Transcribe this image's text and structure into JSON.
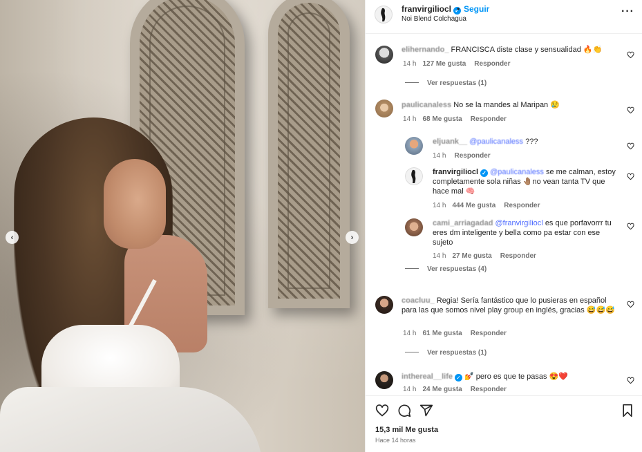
{
  "colors": {
    "accent": "#0095f6",
    "mention": "#4e6bff",
    "muted": "#737373",
    "text": "#262626"
  },
  "photo": {
    "prev_icon": "chevron-left-icon",
    "next_icon": "chevron-right-icon"
  },
  "header": {
    "username": "franvirgiliocl",
    "separator": "•",
    "follow_label": "Seguir",
    "location": "Noi Blend Colchagua",
    "more_icon": "more-options-icon"
  },
  "comments": [
    {
      "user": "elihernando_",
      "text": "FRANCISCA diste clase y sensualidad 🔥👏",
      "time": "14 h",
      "likes": "127 Me gusta",
      "reply": "Responder",
      "view_replies": "Ver respuestas (1)"
    },
    {
      "user": "paulicanaless",
      "text": "No se la mandes al Maripan 😢",
      "time": "14 h",
      "likes": "68 Me gusta",
      "reply": "Responder",
      "replies": [
        {
          "user": "eljuank__",
          "mention": "@paulicanaless",
          "text": "???",
          "time": "14 h",
          "reply": "Responder"
        },
        {
          "user": "franvirgiliocl",
          "mention": "@paulicanaless",
          "text": "se me calman, estoy completamente sola niñas 🤚🏽no vean tanta TV que hace mal 🧠",
          "time": "14 h",
          "likes": "444 Me gusta",
          "reply": "Responder"
        },
        {
          "user": "cami_arriagadad",
          "mention": "@franvirgiliocl",
          "text": "es que porfavorrr tu eres dm inteligente y bella como pa estar con ese sujeto",
          "time": "14 h",
          "likes": "27 Me gusta",
          "reply": "Responder"
        }
      ],
      "view_replies": "Ver respuestas (4)"
    },
    {
      "user": "coacluu_",
      "text": "Regia! Sería fantástico que lo pusieras en español para las que somos nivel play group en inglés, gracias 😅😅😅",
      "time": "14 h",
      "likes": "61 Me gusta",
      "reply": "Responder",
      "view_replies": "Ver respuestas (1)"
    },
    {
      "user": "inthereal__life",
      "text": "💅 pero es que te pasas 😍❤️",
      "time": "14 h",
      "likes": "24 Me gusta",
      "reply": "Responder"
    }
  ],
  "actions": {
    "like_icon": "heart-icon",
    "comment_icon": "comment-icon",
    "share_icon": "share-icon",
    "save_icon": "bookmark-icon",
    "likes_count": "15,3 mil Me gusta",
    "posted": "Hace 14 horas"
  }
}
